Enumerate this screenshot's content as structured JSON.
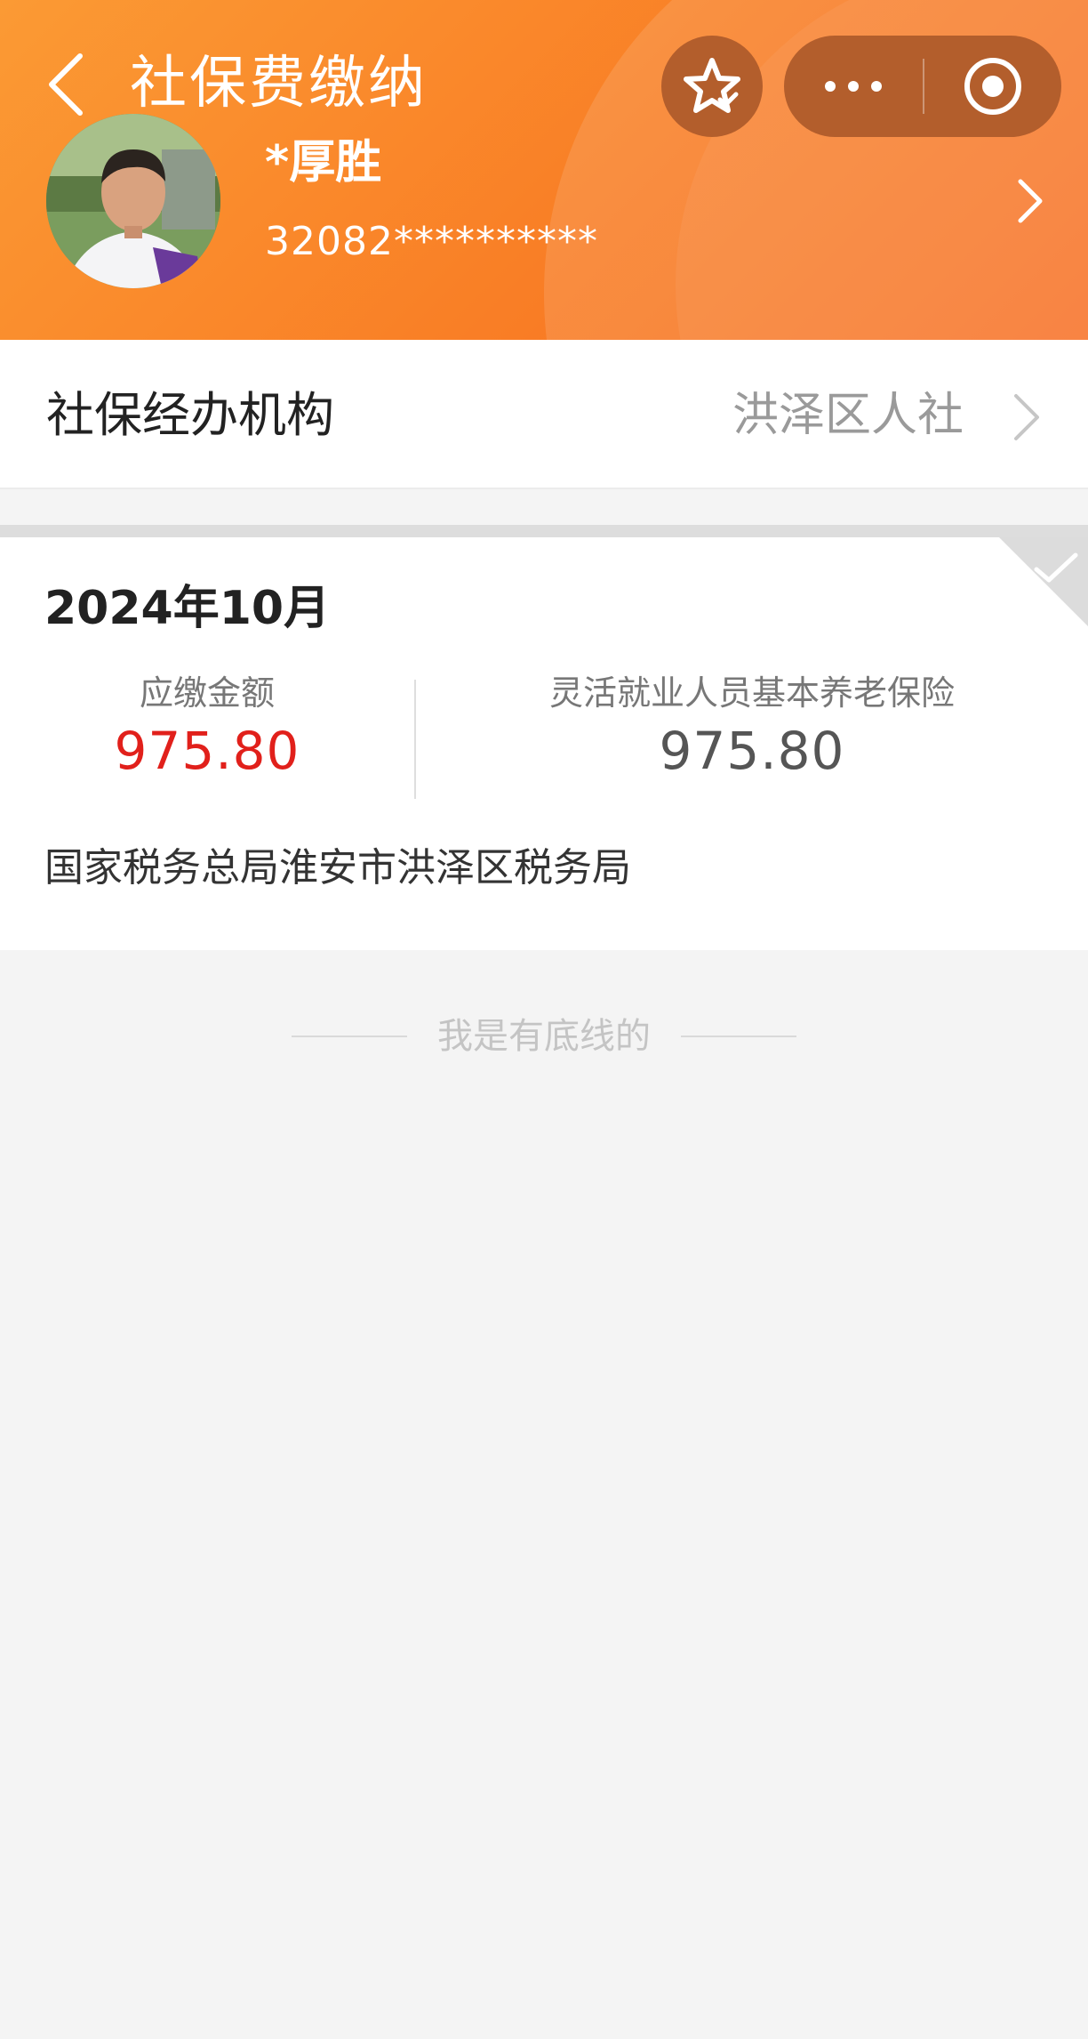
{
  "header": {
    "title": "社保费缴纳",
    "user_name": "*厚胜",
    "user_id": "32082**********",
    "brand_color": "#f98a2b"
  },
  "icons": {
    "back": "back-chevron-icon",
    "star": "star-favorite-icon",
    "more": "more-dots-icon",
    "close": "target-close-icon",
    "arrow": "chevron-right-icon"
  },
  "agency": {
    "label": "社保经办机构",
    "value": "洪泽区人社"
  },
  "record": {
    "period": "2024年10月",
    "due_label": "应缴金额",
    "due_amount": "975.80",
    "insurance_label": "灵活就业人员基本养老保险",
    "insurance_amount": "975.80",
    "tax_bureau": "国家税务总局淮安市洪泽区税务局"
  },
  "footer": {
    "bottom_text": "我是有底线的"
  }
}
